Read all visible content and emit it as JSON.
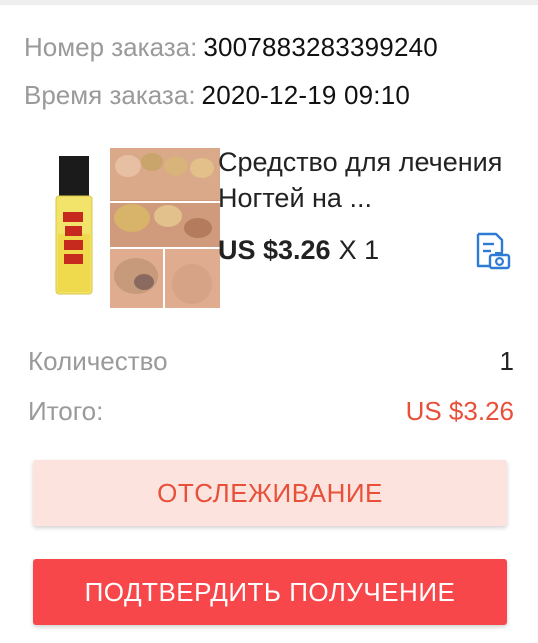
{
  "order": {
    "number_label": "Номер заказа:",
    "number_value": "3007883283399240",
    "time_label": "Время заказа:",
    "time_value": "2020-12-19 09:10"
  },
  "product": {
    "title": "Средство для лечения Ногтей на ...",
    "price": "US $3.26",
    "qty_text": "X 1",
    "image_icon": "product-photo",
    "snapshot_icon": "snapshot-icon"
  },
  "summary": {
    "quantity_label": "Количество",
    "quantity_value": "1",
    "total_label": "Итого:",
    "total_value": "US $3.26"
  },
  "buttons": {
    "track_label": "ОТСЛЕЖИВАНИЕ",
    "confirm_label": "ПОДТВЕРДИТЬ ПОЛУЧЕНИЕ"
  },
  "colors": {
    "accent_red": "#e8503a",
    "confirm_bg": "#f8474a",
    "track_bg": "#fde3de",
    "icon_blue": "#2e7bd6"
  }
}
